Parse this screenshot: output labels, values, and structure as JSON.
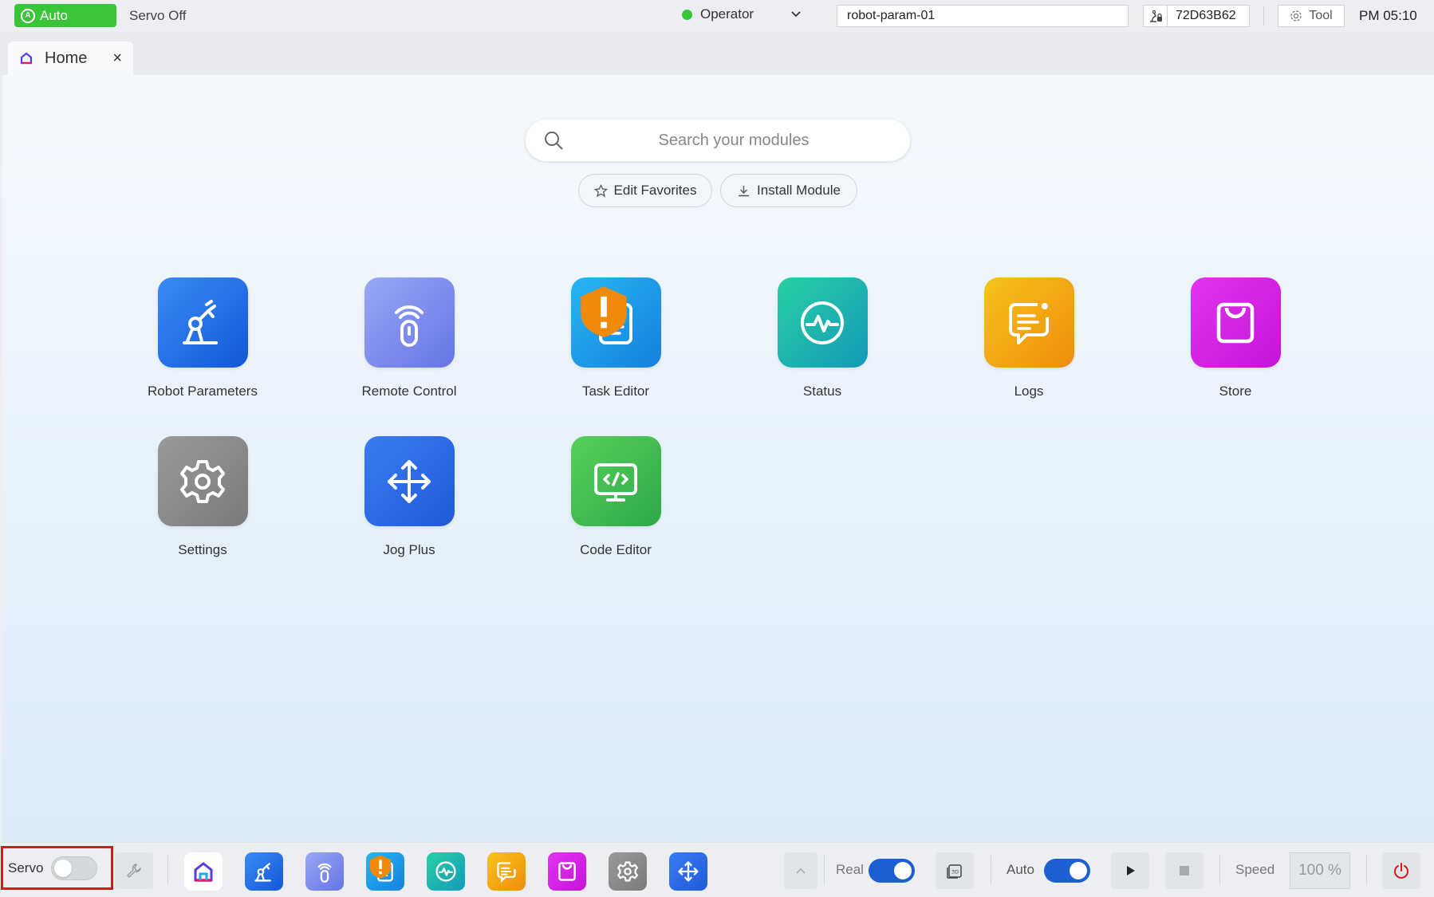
{
  "topbar": {
    "mode": "Auto",
    "servo_status": "Servo Off",
    "role": "Operator",
    "param_file": "robot-param-01",
    "serial": "72D63B62",
    "tool_label": "Tool",
    "clock": "PM 05:10"
  },
  "tabs": [
    {
      "label": "Home",
      "close": "×"
    }
  ],
  "search": {
    "placeholder": "Search your modules"
  },
  "actions": {
    "edit_favorites": "Edit Favorites",
    "install_module": "Install Module"
  },
  "modules": [
    {
      "label": "Robot Parameters",
      "icon": "robot-arm-icon",
      "color": "#1b6fe0"
    },
    {
      "label": "Remote Control",
      "icon": "remote-control-icon",
      "color": "#7d8ef0"
    },
    {
      "label": "Task Editor",
      "icon": "task-editor-icon",
      "color": "#1a9ee6",
      "warning": true
    },
    {
      "label": "Status",
      "icon": "status-pulse-icon",
      "color": "#1ab6a0"
    },
    {
      "label": "Logs",
      "icon": "logs-chat-icon",
      "color": "#f2b10a"
    },
    {
      "label": "Store",
      "icon": "store-bag-icon",
      "color": "#d81ee6"
    },
    {
      "label": "Settings",
      "icon": "settings-gear-icon",
      "color": "#8a8a8a"
    },
    {
      "label": "Jog Plus",
      "icon": "jog-arrows-icon",
      "color": "#2a6de8"
    },
    {
      "label": "Code Editor",
      "icon": "code-editor-icon",
      "color": "#3cb84a"
    }
  ],
  "taskbar": {
    "servo_label": "Servo",
    "servo_on": false,
    "real_label": "Real",
    "real_on": true,
    "auto_label": "Auto",
    "auto_on": true,
    "speed_label": "Speed",
    "speed_value": "100 %"
  },
  "colors": {
    "accent": "#1b5fd0",
    "mode_green": "#3ac43a",
    "power_red": "#e0141b"
  }
}
